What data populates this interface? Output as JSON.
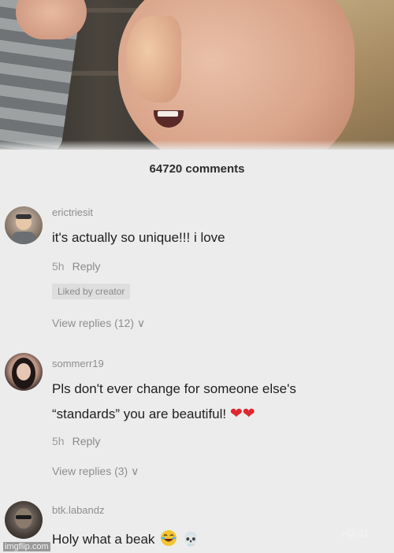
{
  "video": {
    "description_icon": "video-frame"
  },
  "comments_count": "64720 comments",
  "comments": [
    {
      "username": "erictriesit",
      "text": "it's actually so unique!!! i love",
      "time": "5h",
      "reply_label": "Reply",
      "badge": "Liked by creator",
      "view_replies": "View replies (12)"
    },
    {
      "username": "sommerr19",
      "text_line1": "Pls don't ever change for someone else's",
      "text_line2": "“standards” you are beautiful!",
      "time": "5h",
      "reply_label": "Reply",
      "view_replies": "View replies (3)"
    },
    {
      "username": "btk.labandz",
      "text": "Holy what a beak"
    }
  ],
  "watermarks": {
    "tiktok": "♪@91",
    "imgflip": "imgflip.com"
  },
  "icons": {
    "chevron": "∨",
    "heart": "❤",
    "skull": "💀"
  }
}
